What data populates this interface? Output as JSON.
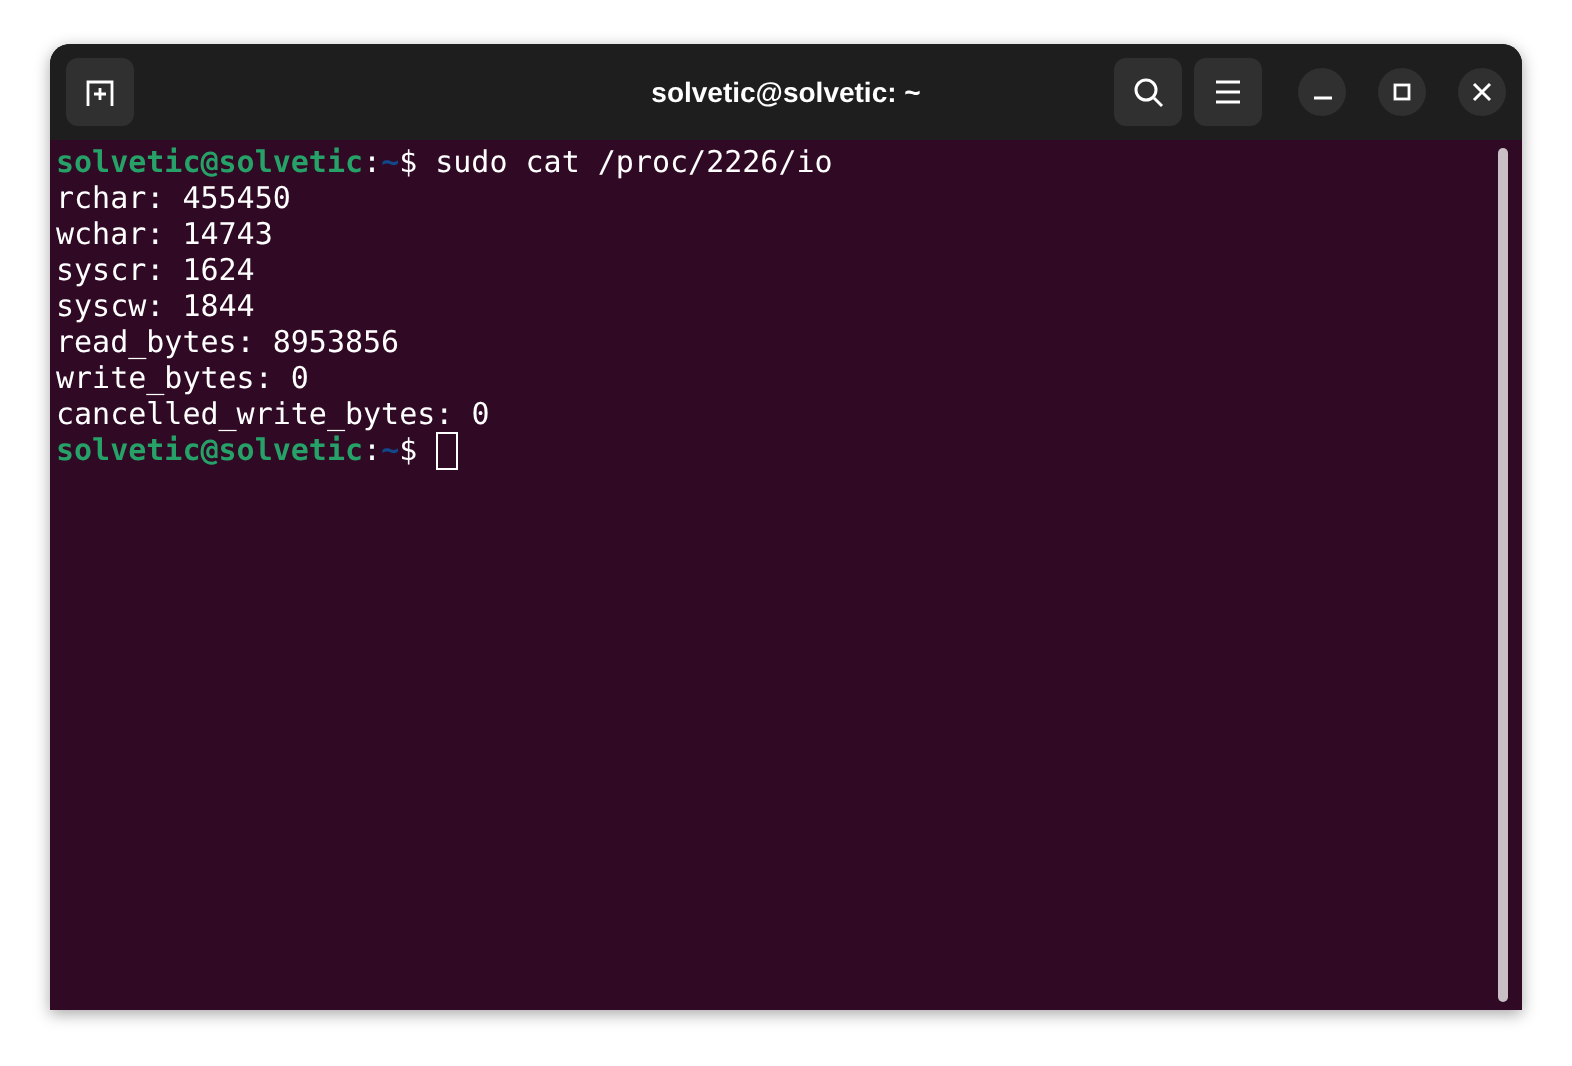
{
  "window": {
    "title": "solvetic@solvetic: ~"
  },
  "terminal": {
    "lines": [
      {
        "kind": "prompt",
        "user_host": "solvetic@solvetic",
        "separator": ":",
        "path": "~",
        "symbol": "$",
        "command": "sudo cat /proc/2226/io",
        "cursor": false
      },
      {
        "kind": "output",
        "text": "rchar: 455450"
      },
      {
        "kind": "output",
        "text": "wchar: 14743"
      },
      {
        "kind": "output",
        "text": "syscr: 1624"
      },
      {
        "kind": "output",
        "text": "syscw: 1844"
      },
      {
        "kind": "output",
        "text": "read_bytes: 8953856"
      },
      {
        "kind": "output",
        "text": "write_bytes: 0"
      },
      {
        "kind": "output",
        "text": "cancelled_write_bytes: 0"
      },
      {
        "kind": "prompt",
        "user_host": "solvetic@solvetic",
        "separator": ":",
        "path": "~",
        "symbol": "$",
        "cursor": true
      }
    ]
  }
}
